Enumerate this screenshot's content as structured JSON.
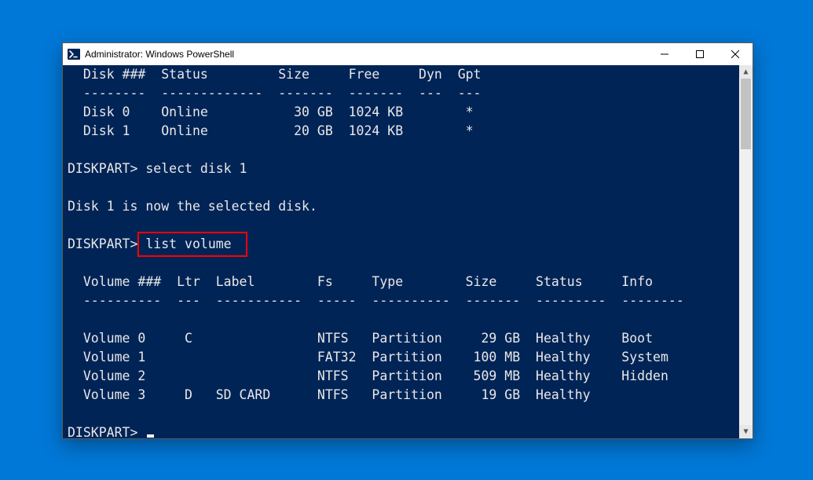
{
  "window": {
    "title": "Administrator: Windows PowerShell"
  },
  "console": {
    "disk_header": "  Disk ###  Status         Size     Free     Dyn  Gpt",
    "disk_separator": "  --------  -------------  -------  -------  ---  ---",
    "disks": [
      "  Disk 0    Online           30 GB  1024 KB        *",
      "  Disk 1    Online           20 GB  1024 KB        *"
    ],
    "prompt1_prefix": "DISKPART> ",
    "cmd1": "select disk 1",
    "msg1": "Disk 1 is now the selected disk.",
    "prompt2_prefix": "DISKPART> ",
    "cmd2": "list volume",
    "vol_header": "  Volume ###  Ltr  Label        Fs     Type        Size     Status     Info",
    "vol_separator": "  ----------  ---  -----------  -----  ----------  -------  ---------  --------",
    "volumes": [
      "  Volume 0     C                NTFS   Partition     29 GB  Healthy    Boot",
      "  Volume 1                      FAT32  Partition    100 MB  Healthy    System",
      "  Volume 2                      NTFS   Partition    509 MB  Healthy    Hidden",
      "  Volume 3     D   SD CARD      NTFS   Partition     19 GB  Healthy"
    ],
    "prompt3_prefix": "DISKPART> "
  }
}
